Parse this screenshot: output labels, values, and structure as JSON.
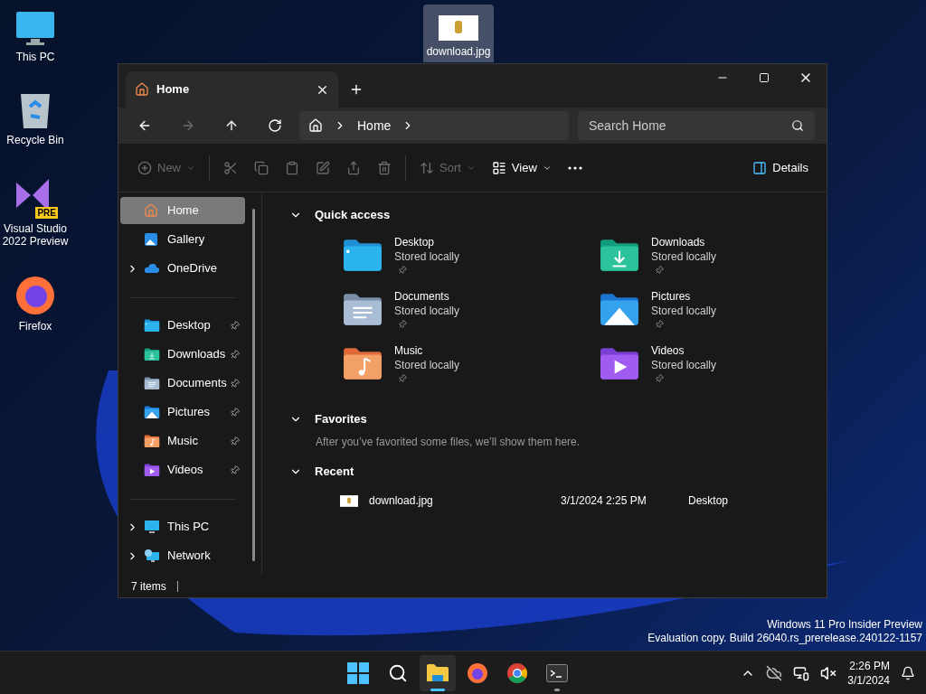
{
  "desktop_icons": [
    {
      "label": "This PC",
      "kind": "pc",
      "selected": false
    },
    {
      "label": "Recycle Bin",
      "kind": "recycle",
      "selected": false
    },
    {
      "label": "Visual Studio 2022 Preview",
      "kind": "vs",
      "badge": "PRE",
      "selected": false
    },
    {
      "label": "Firefox",
      "kind": "firefox",
      "selected": false
    }
  ],
  "dragged_icon": {
    "label": "download.jpg",
    "kind": "image",
    "selected": true
  },
  "window": {
    "tab": {
      "title": "Home"
    },
    "breadcrumb": [
      "Home"
    ],
    "search": {
      "placeholder": "Search Home"
    },
    "nav_buttons": [
      {
        "kind": "back",
        "disabled": false
      },
      {
        "kind": "forward",
        "disabled": true
      },
      {
        "kind": "up",
        "disabled": false
      },
      {
        "kind": "refresh",
        "disabled": false
      }
    ],
    "toolbar": [
      {
        "kind": "new",
        "label": "New",
        "disabled": true
      },
      {
        "kind": "separator"
      },
      {
        "kind": "cut",
        "disabled": true
      },
      {
        "kind": "copy",
        "disabled": true
      },
      {
        "kind": "paste",
        "disabled": true
      },
      {
        "kind": "rename",
        "disabled": true
      },
      {
        "kind": "share",
        "disabled": true
      },
      {
        "kind": "delete",
        "disabled": true
      },
      {
        "kind": "separator"
      },
      {
        "kind": "sort",
        "label": "Sort",
        "disabled": true
      },
      {
        "kind": "view",
        "label": "View",
        "disabled": false
      },
      {
        "kind": "more",
        "disabled": false
      }
    ],
    "details_button": {
      "label": "Details"
    },
    "sidebar": [
      [
        {
          "label": "Home",
          "kind": "home",
          "selected": true,
          "expandable": false,
          "pinned": false
        },
        {
          "label": "Gallery",
          "kind": "gallery",
          "selected": false,
          "expandable": false,
          "pinned": false
        },
        {
          "label": "OneDrive",
          "kind": "cloud",
          "selected": false,
          "expandable": true,
          "pinned": false
        }
      ],
      [
        {
          "label": "Desktop",
          "kind": "desktop",
          "selected": false,
          "expandable": false,
          "pinned": true
        },
        {
          "label": "Downloads",
          "kind": "downloads",
          "selected": false,
          "expandable": false,
          "pinned": true
        },
        {
          "label": "Documents",
          "kind": "documents",
          "selected": false,
          "expandable": false,
          "pinned": true
        },
        {
          "label": "Pictures",
          "kind": "pictures",
          "selected": false,
          "expandable": false,
          "pinned": true
        },
        {
          "label": "Music",
          "kind": "music",
          "selected": false,
          "expandable": false,
          "pinned": true
        },
        {
          "label": "Videos",
          "kind": "videos",
          "selected": false,
          "expandable": false,
          "pinned": true
        }
      ],
      [
        {
          "label": "This PC",
          "kind": "pc",
          "selected": false,
          "expandable": true,
          "pinned": false
        },
        {
          "label": "Network",
          "kind": "network",
          "selected": false,
          "expandable": true,
          "pinned": false
        }
      ]
    ],
    "sections": [
      {
        "title": "Quick access",
        "expanded": true,
        "kind": "tiles",
        "tiles": [
          {
            "name": "Desktop",
            "status": "Stored locally",
            "kind": "desktop",
            "pinned": true
          },
          {
            "name": "Downloads",
            "status": "Stored locally",
            "kind": "downloads",
            "pinned": true
          },
          {
            "name": "Documents",
            "status": "Stored locally",
            "kind": "documents",
            "pinned": true
          },
          {
            "name": "Pictures",
            "status": "Stored locally",
            "kind": "pictures",
            "pinned": true
          },
          {
            "name": "Music",
            "status": "Stored locally",
            "kind": "music",
            "pinned": true
          },
          {
            "name": "Videos",
            "status": "Stored locally",
            "kind": "videos",
            "pinned": true
          }
        ]
      },
      {
        "title": "Favorites",
        "expanded": true,
        "kind": "message",
        "message": "After you’ve favorited some files, we’ll show them here."
      },
      {
        "title": "Recent",
        "expanded": true,
        "kind": "files",
        "files": [
          {
            "name": "download.jpg",
            "date": "3/1/2024 2:25 PM",
            "location": "Desktop"
          }
        ]
      }
    ],
    "status_bar": {
      "items": "7 items"
    }
  },
  "watermark_os": [
    "Windows 11 Pro Insider Preview",
    "Evaluation copy. Build 26040.rs_prerelease.240122-1157"
  ],
  "taskbar": {
    "apps": [
      {
        "kind": "start",
        "active": false,
        "running": false
      },
      {
        "kind": "search",
        "active": false,
        "running": false
      },
      {
        "kind": "explorer",
        "active": true,
        "running": true
      },
      {
        "kind": "firefox",
        "active": false,
        "running": false
      },
      {
        "kind": "chrome",
        "active": false,
        "running": false
      },
      {
        "kind": "terminal",
        "active": false,
        "running": true
      }
    ],
    "tray": [
      {
        "kind": "chevron"
      },
      {
        "kind": "onedrive-off"
      },
      {
        "kind": "network"
      },
      {
        "kind": "volume-muted"
      }
    ],
    "time": "2:26 PM",
    "date": "3/1/2024"
  }
}
